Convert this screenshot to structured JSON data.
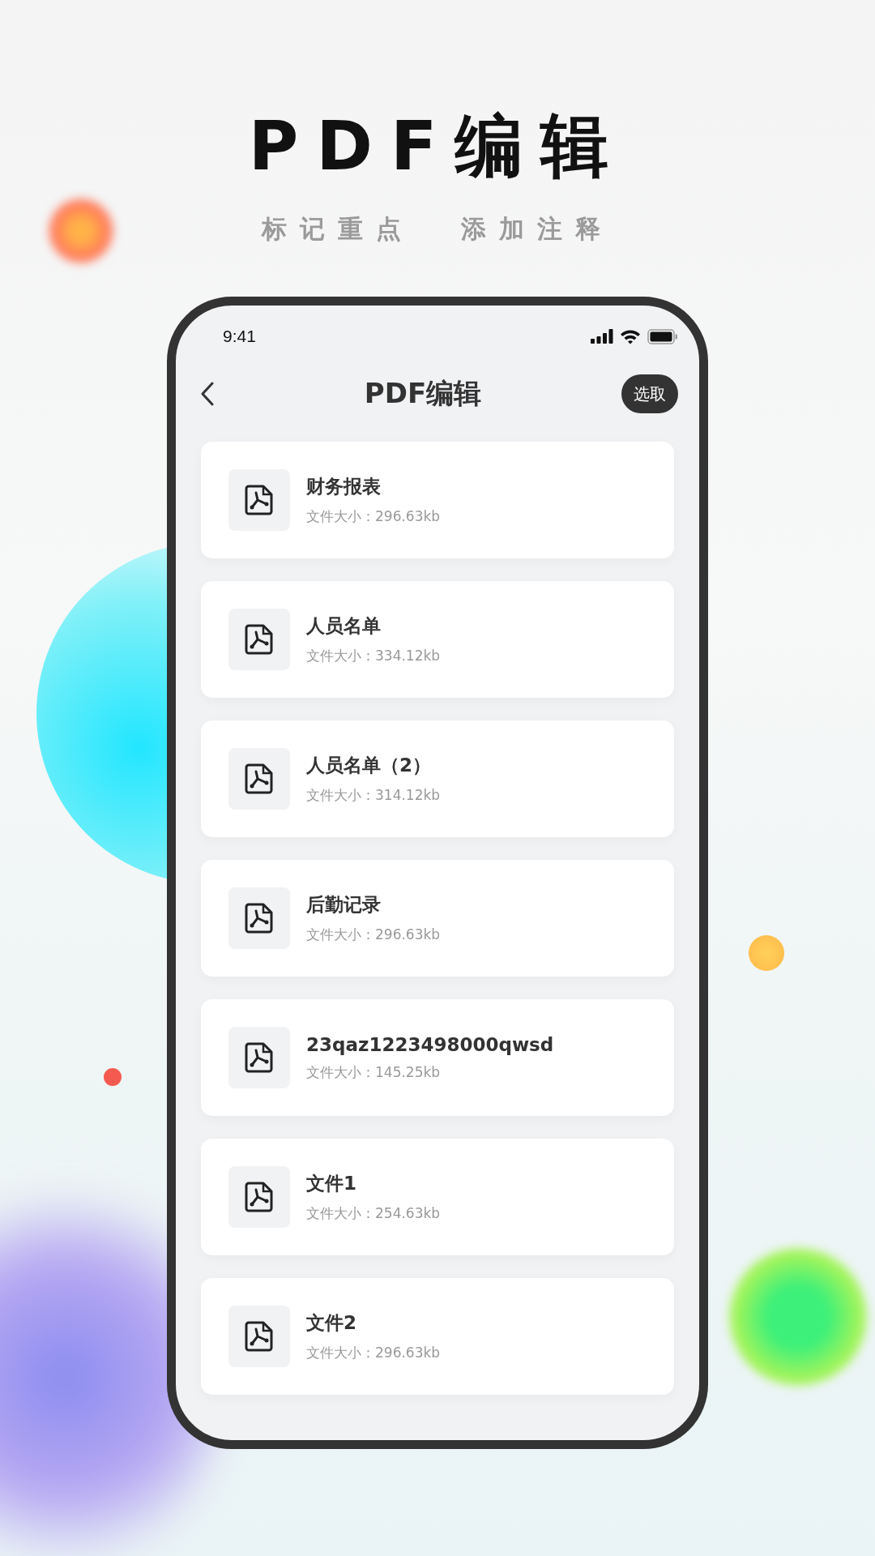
{
  "headline": "PDF编辑",
  "taglines": [
    "标记重点",
    "添加注释"
  ],
  "status_bar": {
    "time": "9:41"
  },
  "nav": {
    "title": "PDF编辑",
    "action": "选取"
  },
  "files": [
    {
      "name": "财务报表",
      "size": "文件大小：296.63kb"
    },
    {
      "name": "人员名单",
      "size": "文件大小：334.12kb"
    },
    {
      "name": "人员名单（2）",
      "size": "文件大小：314.12kb"
    },
    {
      "name": "后勤记录",
      "size": "文件大小：296.63kb"
    },
    {
      "name": "23qaz1223498000qwsd",
      "size": "文件大小：145.25kb"
    },
    {
      "name": "文件1",
      "size": "文件大小：254.63kb"
    },
    {
      "name": "文件2",
      "size": "文件大小：296.63kb"
    }
  ]
}
